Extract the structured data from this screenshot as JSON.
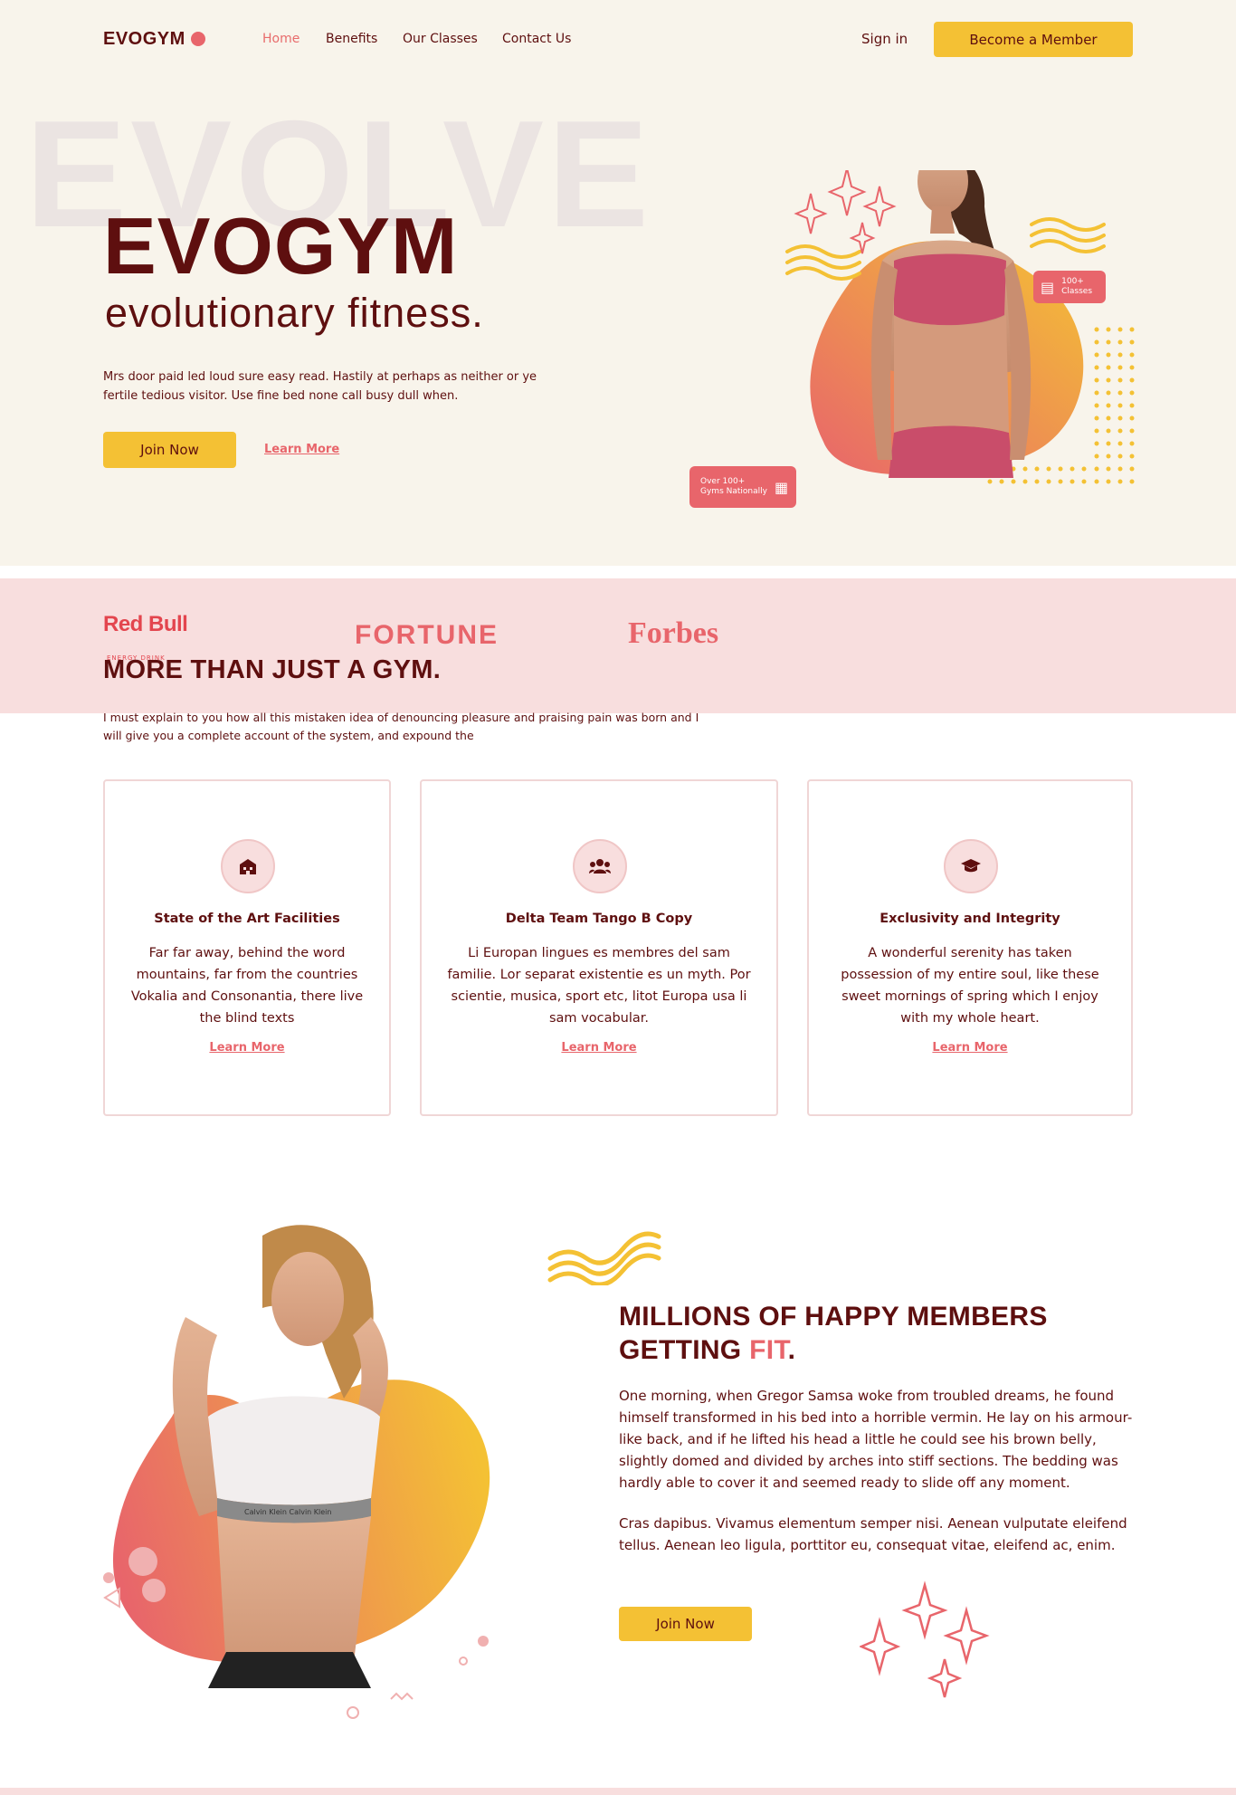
{
  "brand": {
    "name": "EVOGYM"
  },
  "nav": {
    "links": [
      "Home",
      "Benefits",
      "Our Classes",
      "Contact Us"
    ],
    "sign_in": "Sign in",
    "cta": "Become a Member"
  },
  "hero": {
    "bg_word": "EVOLVE",
    "title": "EVOGYM",
    "subtitle": "evolutionary fitness.",
    "description": "Mrs door paid led loud sure easy read. Hastily at perhaps as neither or ye fertile tedious visitor. Use fine bed none call busy dull when.",
    "join": "Join Now",
    "learn": "Learn More",
    "badge_classes_line1": "100+",
    "badge_classes_line2": "Classes",
    "badge_gyms_line1": "Over 100+",
    "badge_gyms_line2": "Gyms Nationally"
  },
  "sponsors": {
    "redbull": "Red Bull",
    "redbull_sub": "ENERGY DRINK",
    "fortune": "FORTUNE",
    "forbes": "Forbes"
  },
  "benefits": {
    "title": "MORE THAN JUST A GYM.",
    "description": "I must explain to you how all this mistaken idea of denouncing pleasure and praising pain was born and I will give you a complete account of the system, and expound the",
    "cards": [
      {
        "icon": "building-icon",
        "title": "State of the Art Facilities",
        "text": "Far far away, behind the word mountains, far from the countries Vokalia and Consonantia, there live the blind texts",
        "link": "Learn More"
      },
      {
        "icon": "group-icon",
        "title": "Delta Team Tango B Copy",
        "text": "Li Europan lingues es membres del sam familie. Lor separat existentie es un myth. Por scientie, musica, sport etc, litot Europa usa li sam vocabular.",
        "link": "Learn More"
      },
      {
        "icon": "graduation-cap-icon",
        "title": "Exclusivity and Integrity",
        "text": "A wonderful serenity has taken possession of my entire soul, like these sweet mornings of spring which I enjoy with my whole heart.",
        "link": "Learn More"
      }
    ]
  },
  "members": {
    "title_line1": "MILLIONS OF HAPPY MEMBERS",
    "title_line2": "GETTING ",
    "title_accent": "FIT",
    "title_end": ".",
    "p1": "One morning, when Gregor Samsa woke from troubled dreams, he found himself transformed in his bed into a horrible vermin. He lay on his armour-like back, and if he lifted his head a little he could see his brown belly, slightly domed and divided by arches into stiff sections. The bedding was hardly able to cover it and seemed ready to slide off any moment.",
    "p2": "Cras dapibus. Vivamus elementum semper nisi. Aenean vulputate eleifend tellus. Aenean leo ligula, porttitor eu, consequat vitae, eleifend ac, enim.",
    "join": "Join Now"
  },
  "colors": {
    "primary_dark": "#5e0f0f",
    "accent_red": "#e8656b",
    "accent_yellow": "#f4c134",
    "hero_bg": "#f8f4eb",
    "pink_bg": "#f8dede"
  }
}
